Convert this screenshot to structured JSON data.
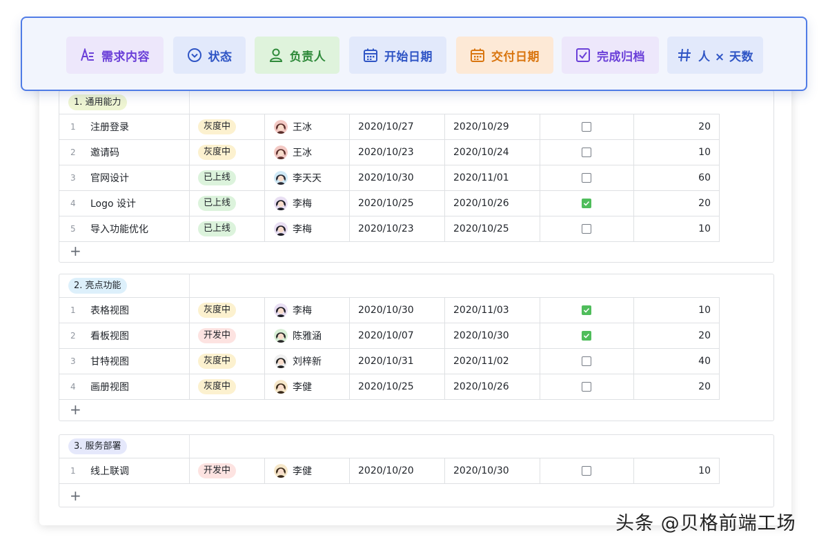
{
  "fields": [
    {
      "label": "需求内容",
      "icon": "text-field-icon",
      "bg": "#ede7fb",
      "fg": "#6a3fd8"
    },
    {
      "label": "状态",
      "icon": "status-circle-icon",
      "bg": "#e2e9fb",
      "fg": "#2f55c5"
    },
    {
      "label": "负责人",
      "icon": "person-icon",
      "bg": "#dff3dc",
      "fg": "#2f8a3a"
    },
    {
      "label": "开始日期",
      "icon": "calendar-icon",
      "bg": "#e2e9fb",
      "fg": "#2f55c5"
    },
    {
      "label": "交付日期",
      "icon": "calendar-icon",
      "bg": "#fde9d6",
      "fg": "#d9750f"
    },
    {
      "label": "完成归档",
      "icon": "checkbox-icon",
      "bg": "#ede7fb",
      "fg": "#6a3fd8"
    },
    {
      "label": "人 × 天数",
      "icon": "number-hash-icon",
      "bg": "#e2e9fb",
      "fg": "#2f55c5"
    }
  ],
  "groups": [
    {
      "tag": "1. 通用能力",
      "tag_bg": "#eef5d2",
      "rows": [
        {
          "idx": "1",
          "title": "注册登录",
          "status": "灰度中",
          "owner": "王冰",
          "start": "2020/10/27",
          "end": "2020/10/29",
          "done": false,
          "days": "20"
        },
        {
          "idx": "2",
          "title": "邀请码",
          "status": "灰度中",
          "owner": "王冰",
          "start": "2020/10/23",
          "end": "2020/10/24",
          "done": false,
          "days": "10"
        },
        {
          "idx": "3",
          "title": "官网设计",
          "status": "已上线",
          "owner": "李天天",
          "start": "2020/10/30",
          "end": "2020/11/01",
          "done": false,
          "days": "60"
        },
        {
          "idx": "4",
          "title": "Logo 设计",
          "status": "已上线",
          "owner": "李梅",
          "start": "2020/10/25",
          "end": "2020/10/26",
          "done": true,
          "days": "20"
        },
        {
          "idx": "5",
          "title": "导入功能优化",
          "status": "已上线",
          "owner": "李梅",
          "start": "2020/10/23",
          "end": "2020/10/25",
          "done": false,
          "days": "10"
        }
      ]
    },
    {
      "tag": "2. 亮点功能",
      "tag_bg": "#ddf0fb",
      "rows": [
        {
          "idx": "1",
          "title": "表格视图",
          "status": "灰度中",
          "owner": "李梅",
          "start": "2020/10/30",
          "end": "2020/11/03",
          "done": true,
          "days": "10"
        },
        {
          "idx": "2",
          "title": "看板视图",
          "status": "开发中",
          "owner": "陈雅涵",
          "start": "2020/10/07",
          "end": "2020/10/30",
          "done": true,
          "days": "20"
        },
        {
          "idx": "3",
          "title": "甘特视图",
          "status": "灰度中",
          "owner": "刘梓新",
          "start": "2020/10/31",
          "end": "2020/11/02",
          "done": false,
          "days": "40"
        },
        {
          "idx": "4",
          "title": "画册视图",
          "status": "灰度中",
          "owner": "李健",
          "start": "2020/10/25",
          "end": "2020/10/26",
          "done": false,
          "days": "20"
        }
      ]
    },
    {
      "tag": "3. 服务部署",
      "tag_bg": "#e5e8fb",
      "rows": [
        {
          "idx": "1",
          "title": "线上联调",
          "status": "开发中",
          "owner": "李健",
          "start": "2020/10/20",
          "end": "2020/10/30",
          "done": false,
          "days": "10"
        }
      ]
    }
  ],
  "status_colors": {
    "灰度中": {
      "bg": "#fcf1cf",
      "fg": "#1f2329"
    },
    "已上线": {
      "bg": "#dcf3dc",
      "fg": "#1f2329"
    },
    "开发中": {
      "bg": "#fde3e1",
      "fg": "#1f2329"
    }
  },
  "add_icon": "plus-icon",
  "watermark": "头条 @贝格前端工场"
}
